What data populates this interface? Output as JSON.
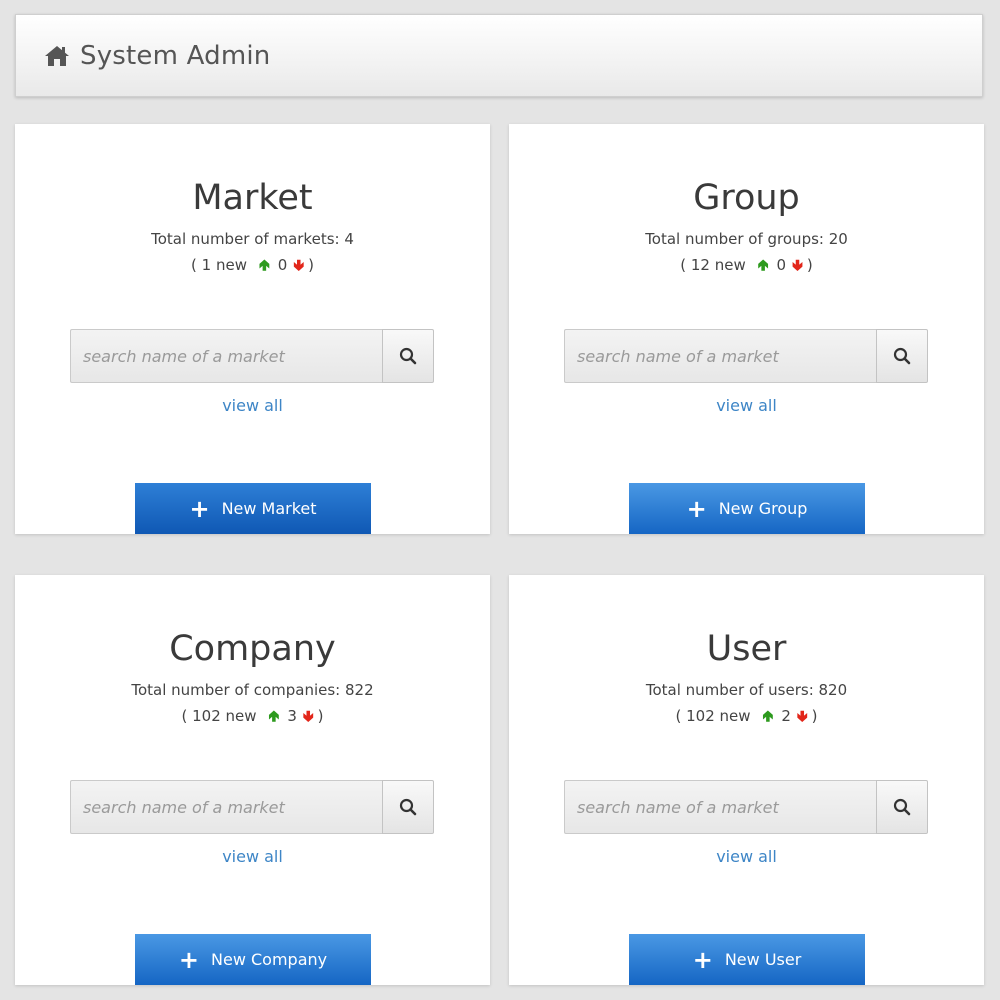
{
  "header": {
    "icon": "home-icon",
    "title": "System Admin"
  },
  "cards": [
    {
      "title": "Market",
      "total_text": "Total number of markets: 4",
      "new_text": "( 1 new",
      "up_count": "0",
      "close": ")",
      "search_placeholder": "search name of a market",
      "view_all": "view all",
      "button_label": "New Market"
    },
    {
      "title": "Group",
      "total_text": "Total number of groups: 20",
      "new_text": "( 12 new",
      "up_count": "0",
      "close": ")",
      "search_placeholder": "search name of a market",
      "view_all": "view all",
      "button_label": "New Group"
    },
    {
      "title": "Company",
      "total_text": "Total number of companies: 822",
      "new_text": "( 102 new",
      "up_count": "3",
      "close": ")",
      "search_placeholder": "search name of a market",
      "view_all": "view all",
      "button_label": "New Company"
    },
    {
      "title": "User",
      "total_text": "Total number of users: 820",
      "new_text": "( 102 new",
      "up_count": "2",
      "close": ")",
      "search_placeholder": "search name of a market",
      "view_all": "view all",
      "button_label": "New User"
    }
  ],
  "colors": {
    "background": "#e4e4e4",
    "accent_blue": "#1566c4",
    "link": "#3d85c6",
    "up_arrow": "#2d9a1e",
    "down_arrow": "#e2261a"
  }
}
